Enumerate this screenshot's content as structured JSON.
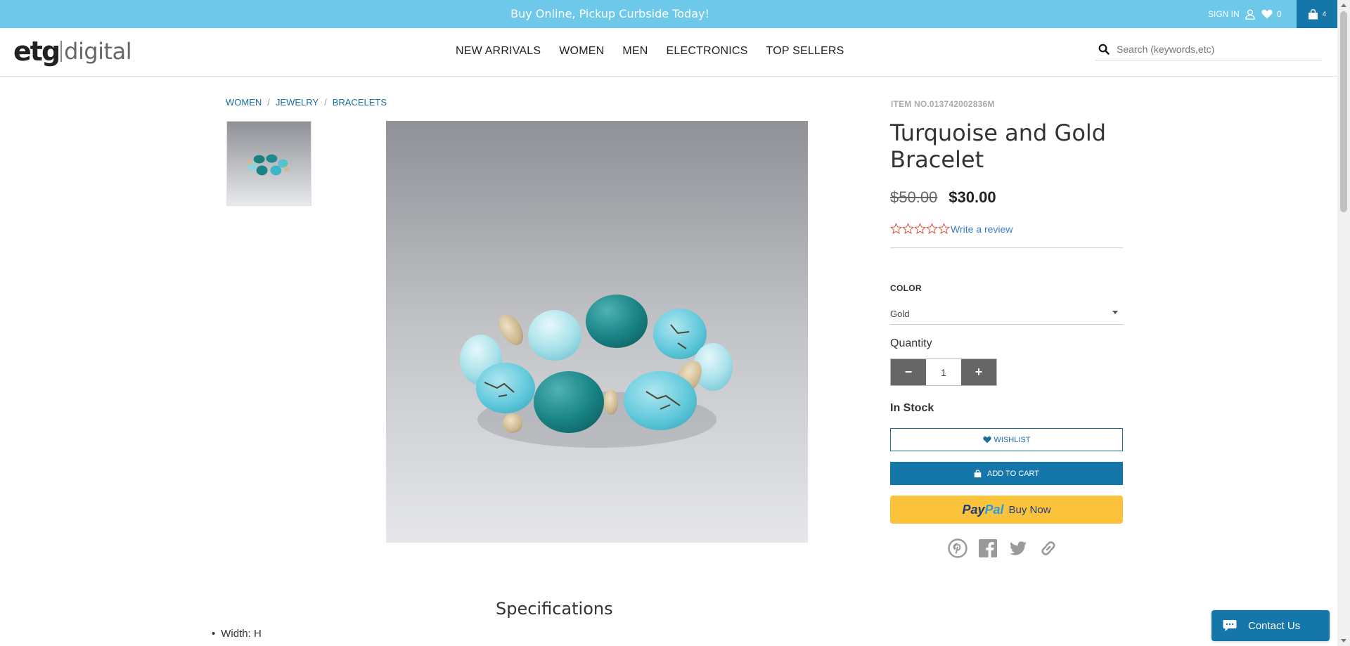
{
  "promo": {
    "text": "Buy Online, Pickup Curbside Today!"
  },
  "account": {
    "sign_in": "SIGN IN",
    "wishlist_count": "0",
    "cart_count": "4"
  },
  "logo": {
    "part1": "etg",
    "part2": "digital"
  },
  "nav": {
    "items": [
      "NEW ARRIVALS",
      "WOMEN",
      "MEN",
      "ELECTRONICS",
      "TOP SELLERS"
    ]
  },
  "search": {
    "placeholder": "Search (keywords,etc)",
    "value": ""
  },
  "breadcrumb": {
    "items": [
      "WOMEN",
      "JEWELRY",
      "BRACELETS"
    ],
    "separator": "/"
  },
  "product": {
    "item_no": "ITEM NO.013742002836M",
    "title": "Turquoise and Gold Bracelet",
    "old_price": "$50.00",
    "price": "$30.00",
    "rating": 0,
    "rating_max": 5,
    "review_link": "Write a review",
    "color_label": "COLOR",
    "color_value": "Gold",
    "quantity_label": "Quantity",
    "quantity_value": "1",
    "quantity_minus": "−",
    "quantity_plus": "+",
    "stock_status": "In Stock",
    "wishlist_label": "WISHLIST",
    "add_to_cart_label": "ADD TO CART",
    "paypal_pay": "Pay",
    "paypal_pal": "Pal",
    "paypal_buy": "Buy Now"
  },
  "share": {
    "icons": [
      "pinterest-icon",
      "facebook-icon",
      "twitter-icon",
      "link-icon"
    ]
  },
  "specs": {
    "title": "Specifications",
    "items": [
      "Width: H"
    ]
  },
  "contact": {
    "label": "Contact Us"
  },
  "colors": {
    "promo_bar": "#6dc8ea",
    "primary_blue": "#1577a9",
    "paypal_yellow": "#fbc33b",
    "star_outline": "#e0533a",
    "link_blue": "#3d7fd0"
  }
}
